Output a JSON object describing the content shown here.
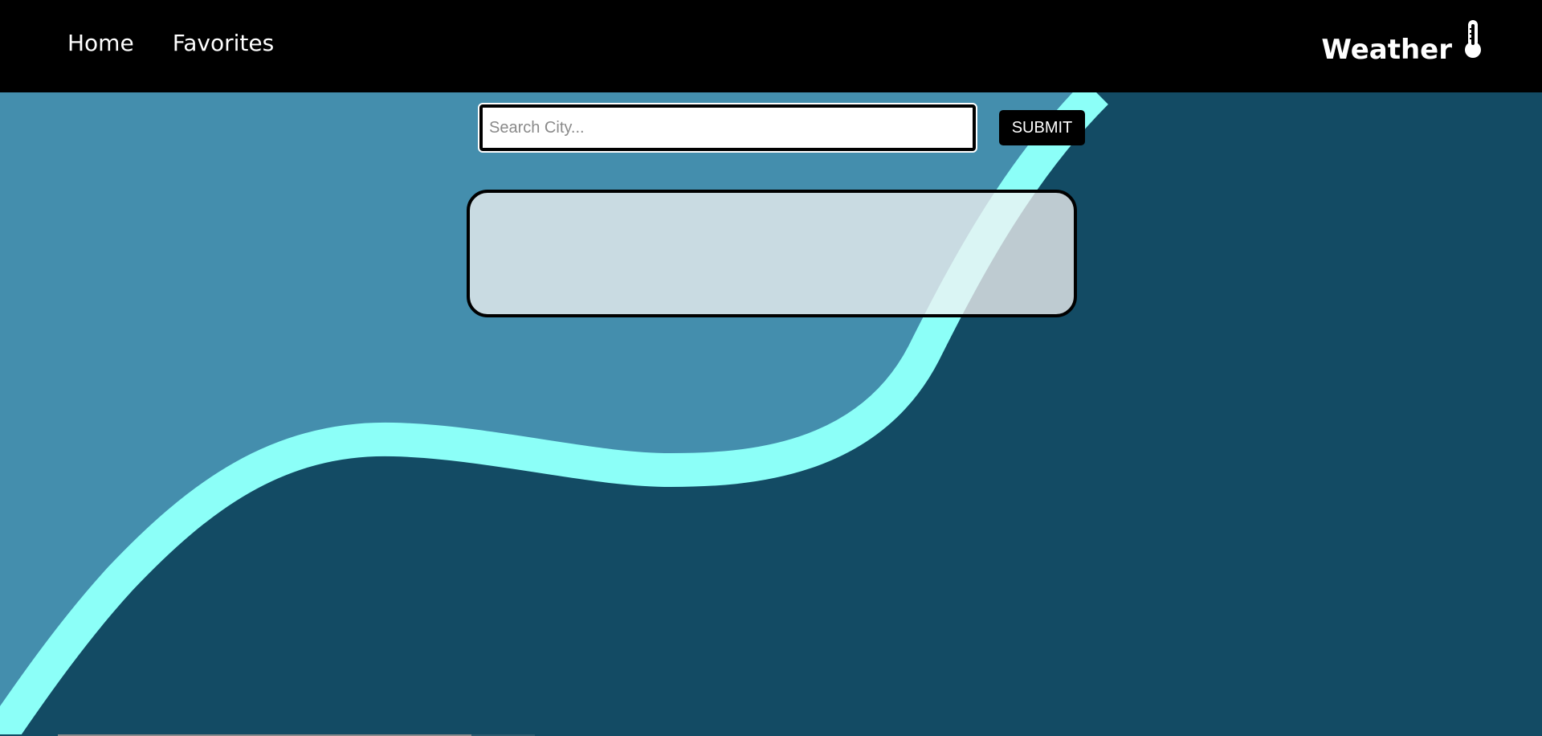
{
  "nav": {
    "home_label": "Home",
    "favorites_label": "Favorites"
  },
  "brand": {
    "name": "Weather",
    "icon": "thermometer-icon"
  },
  "search": {
    "placeholder": "Search City...",
    "value": "",
    "submit_label": "SUBMIT"
  },
  "colors": {
    "header": "#000000",
    "background_light": "#448ead",
    "background_dark": "#134b64",
    "accent_wave": "#8cfff8",
    "panel": "#f2f2f2"
  }
}
